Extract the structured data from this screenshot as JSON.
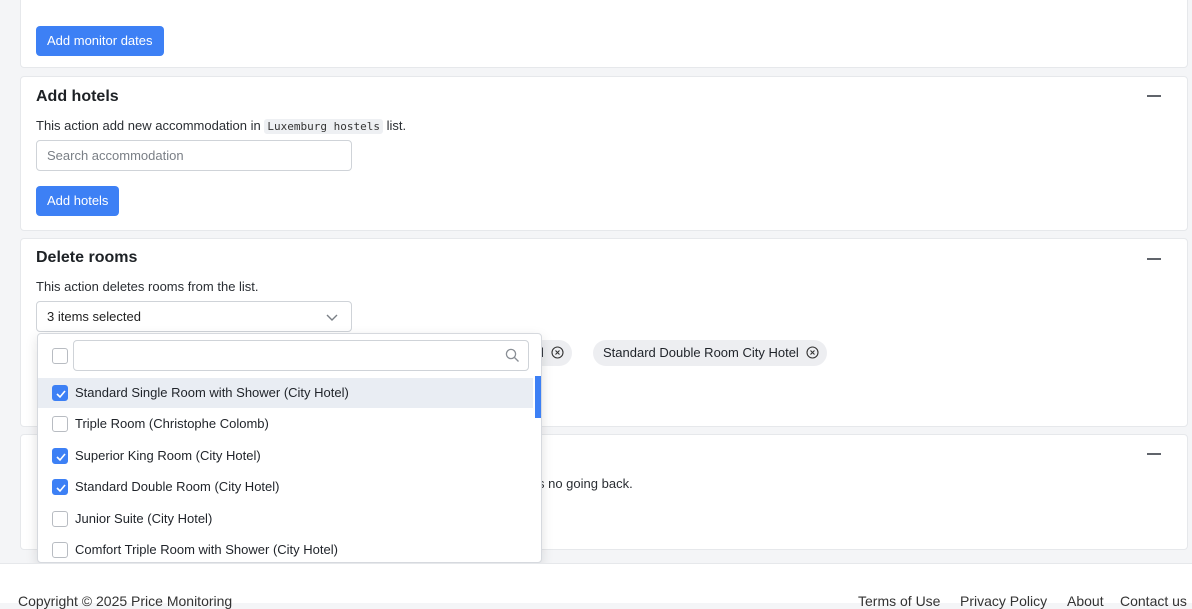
{
  "monitor_dates": {
    "button_label": "Add monitor dates"
  },
  "add_hotels": {
    "title": "Add hotels",
    "desc_prefix": "This action add new accommodation in ",
    "list_name": "Luxemburg hostels",
    "desc_suffix": " list.",
    "search_placeholder": "Search accommodation",
    "button_label": "Add hotels"
  },
  "delete_rooms": {
    "title": "Delete rooms",
    "description": "This action deletes rooms from the list.",
    "select_value": "3 items selected",
    "chips": [
      {
        "label": "tel"
      },
      {
        "label": "Standard Double Room City Hotel"
      }
    ]
  },
  "danger": {
    "description_tail": "s no going back."
  },
  "dropdown": {
    "search_placeholder": "",
    "options": [
      {
        "label": "Standard Single Room with Shower (City Hotel)",
        "checked": true,
        "highlighted": true
      },
      {
        "label": "Triple Room (Christophe Colomb)",
        "checked": false,
        "highlighted": false
      },
      {
        "label": "Superior King Room (City Hotel)",
        "checked": true,
        "highlighted": false
      },
      {
        "label": "Standard Double Room (City Hotel)",
        "checked": true,
        "highlighted": false
      },
      {
        "label": "Junior Suite (City Hotel)",
        "checked": false,
        "highlighted": false
      },
      {
        "label": "Comfort Triple Room with Shower (City Hotel)",
        "checked": false,
        "highlighted": false
      }
    ]
  },
  "footer": {
    "copyright": "Copyright © 2025 Price Monitoring",
    "links": [
      "Terms of Use",
      "Privacy Policy",
      "About",
      "Contact us"
    ]
  },
  "colors": {
    "primary": "#3d80f5",
    "arrow": "#f08c8c"
  }
}
